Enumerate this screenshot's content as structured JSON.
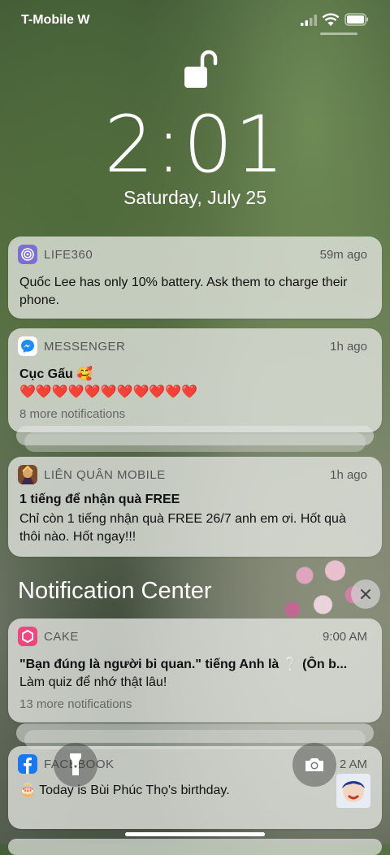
{
  "status_bar": {
    "carrier": "T-Mobile W"
  },
  "clock": {
    "time": "2:01",
    "date": "Saturday, July 25"
  },
  "notifications": [
    {
      "app": "LIFE360",
      "time": "59m ago",
      "title": "",
      "body": "Quốc Lee has only 10% battery. Ask them to charge their phone.",
      "more": ""
    },
    {
      "app": "MESSENGER",
      "time": "1h ago",
      "title": "Cục Gấu 🥰",
      "body": "❤️❤️❤️❤️❤️❤️❤️❤️❤️❤️❤️",
      "more": "8 more notifications"
    },
    {
      "app": "LIÊN QUÂN MOBILE",
      "time": "1h ago",
      "title": "1 tiếng để nhận quà FREE",
      "body": "Chỉ còn 1 tiếng nhận quà FREE 26/7 anh em ơi. Hốt quà thôi nào. Hốt ngay!!!",
      "more": ""
    }
  ],
  "notification_center": {
    "title": "Notification Center"
  },
  "nc_notifications": [
    {
      "app": "CAKE",
      "time": "9:00 AM",
      "title": "\"Bạn đúng là người bi quan.\" tiếng Anh là ❔ (Ôn b...",
      "body": "Làm quiz để nhớ thật lâu!",
      "more": "13 more notifications"
    },
    {
      "app": "FACEBOOK",
      "time": "2 AM",
      "body": "🎂 Today is Bùi Phúc Thọ's birthday."
    }
  ],
  "colors": {
    "life360": "#7b6fd6",
    "messenger": "#1d8cf8",
    "cake": "#f0467f",
    "facebook": "#1877f2"
  }
}
